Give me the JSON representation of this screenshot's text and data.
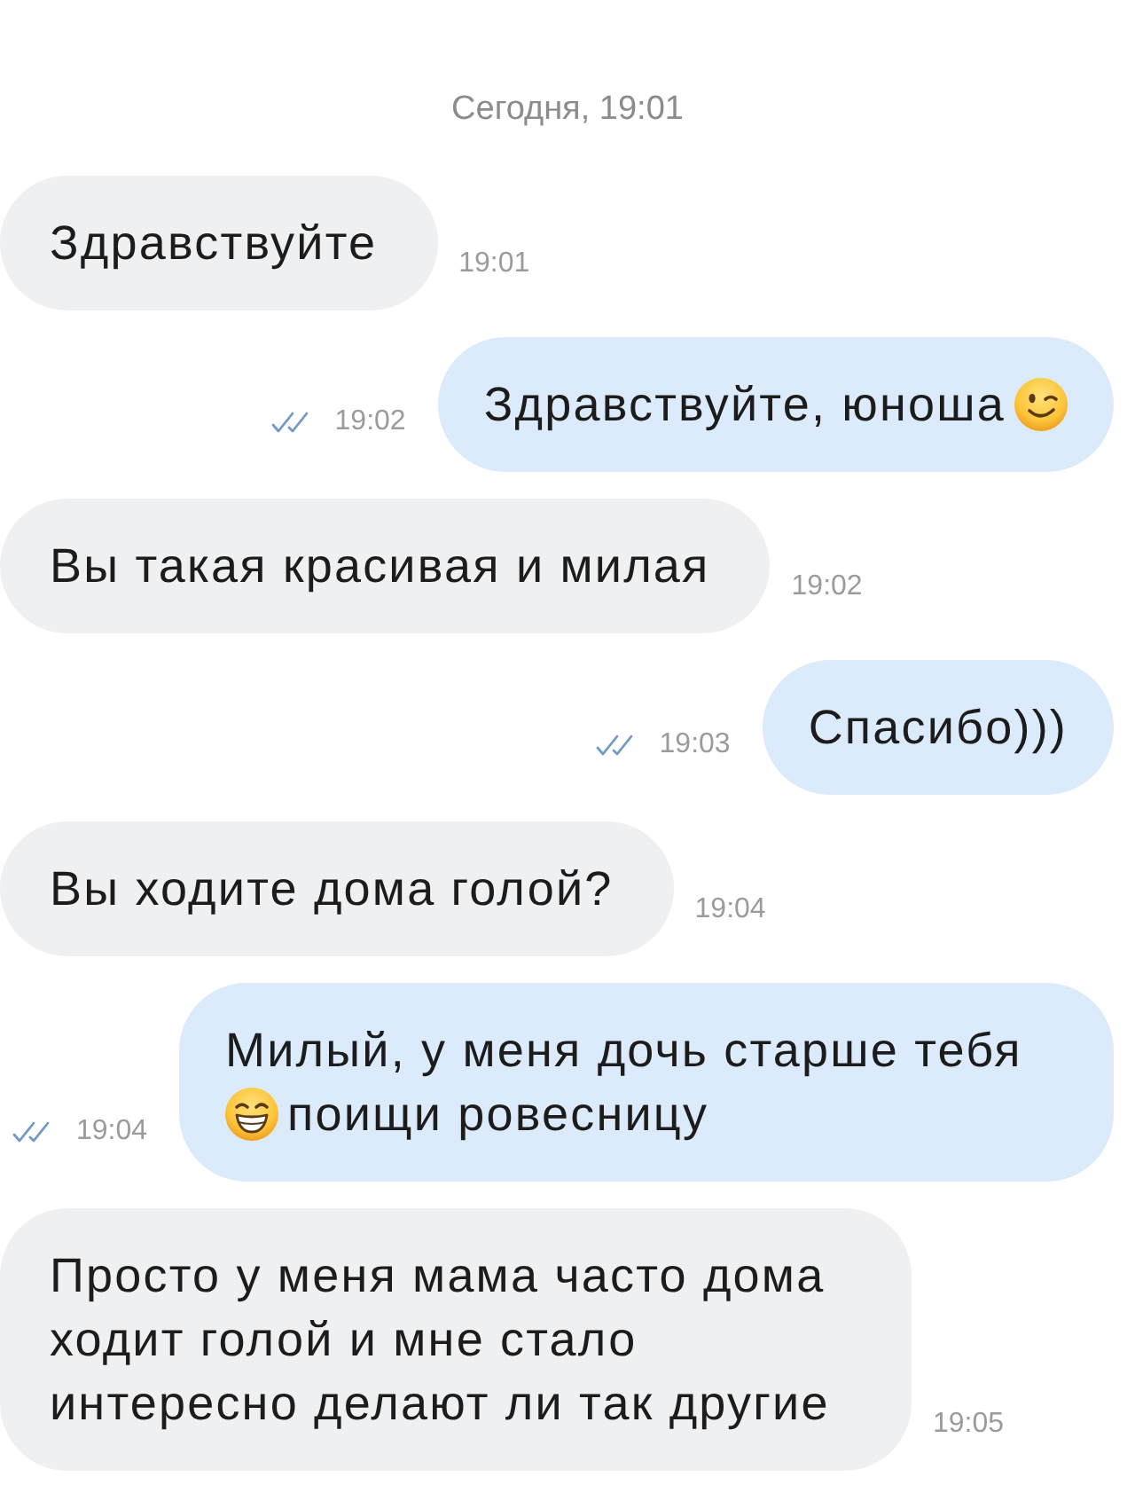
{
  "date_divider": "Сегодня, 19:01",
  "messages": [
    {
      "kind": "incoming",
      "parts": [
        {
          "kind": "text",
          "text": "Здравствуйте"
        }
      ],
      "time": "19:01"
    },
    {
      "kind": "outgoing",
      "parts": [
        {
          "kind": "text",
          "text": "Здравствуйте, юноша"
        },
        {
          "kind": "wink_emoji"
        }
      ],
      "time": "19:02",
      "read": true
    },
    {
      "kind": "incoming",
      "parts": [
        {
          "kind": "text",
          "text": "Вы такая красивая и милая"
        }
      ],
      "time": "19:02"
    },
    {
      "kind": "outgoing",
      "parts": [
        {
          "kind": "text",
          "text": "Спасибо)))"
        }
      ],
      "time": "19:03",
      "read": true
    },
    {
      "kind": "incoming",
      "parts": [
        {
          "kind": "text",
          "text": "Вы ходите дома голой?"
        }
      ],
      "time": "19:04"
    },
    {
      "kind": "outgoing",
      "parts": [
        {
          "kind": "text",
          "text": "Милый, у меня дочь старше тебя"
        },
        {
          "kind": "grin_emoji"
        },
        {
          "kind": "text",
          "text": "поищи ровесницу"
        }
      ],
      "time": "19:04",
      "read": true
    },
    {
      "kind": "incoming",
      "parts": [
        {
          "kind": "text",
          "text": "Просто у меня мама часто дома ходит голой и мне стало интересно делают ли так другие"
        }
      ],
      "time": "19:05"
    }
  ]
}
